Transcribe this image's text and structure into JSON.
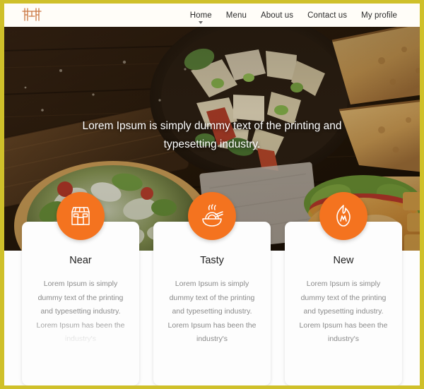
{
  "theme": {
    "frame_color": "#cfc02a",
    "accent_color": "#f4731f",
    "navbar_bg": "#fffdf8",
    "card_bg": "#fdfdfd"
  },
  "navbar": {
    "logo_icon": "restaurant-table-chairs-icon",
    "links": [
      {
        "label": "Home",
        "active": true
      },
      {
        "label": "Menu",
        "active": false
      },
      {
        "label": "About us",
        "active": false
      },
      {
        "label": "Contact us",
        "active": false
      },
      {
        "label": "My profile",
        "active": false
      }
    ]
  },
  "hero": {
    "headline": "Lorem Ipsum is simply dummy text of the printing and typesetting industry.",
    "background_image": "food-table-flatlay-photo"
  },
  "cards": [
    {
      "icon": "storefront-icon",
      "title": "Near",
      "body": "Lorem Ipsum is simply dummy text of the printing and typesetting industry. Lorem Ipsum has been the industry's"
    },
    {
      "icon": "noodle-bowl-icon",
      "title": "Tasty",
      "body": "Lorem Ipsum is simply dummy text of the printing and typesetting industry. Lorem Ipsum has been the industry's"
    },
    {
      "icon": "flame-icon",
      "title": "New",
      "body": "Lorem Ipsum is simply dummy text of the printing and typesetting industry. Lorem Ipsum has been the industry's"
    }
  ]
}
